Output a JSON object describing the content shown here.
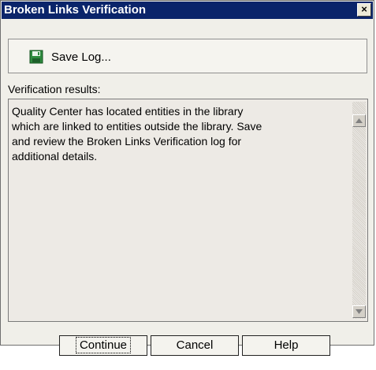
{
  "window": {
    "title": "Broken Links Verification",
    "close_label": "×"
  },
  "toolbar": {
    "save_log_label": "Save Log...",
    "save_log_icon": "floppy-disk-icon"
  },
  "results": {
    "label": "Verification results:",
    "text": "Quality Center has located entities in the library\nwhich are linked to entities outside the library. Save\nand review the Broken Links Verification log for\nadditional details."
  },
  "buttons": {
    "continue_label": "Continue",
    "cancel_label": "Cancel",
    "help_label": "Help"
  },
  "colors": {
    "title_bar": "#0a246a",
    "dialog_background": "#f0efe9",
    "textarea_background": "#edeae5"
  }
}
